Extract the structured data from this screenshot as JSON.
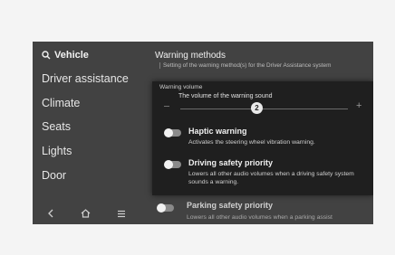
{
  "sidebar": {
    "search_label": "Vehicle",
    "items": [
      {
        "label": "Driver assistance"
      },
      {
        "label": "Climate"
      },
      {
        "label": "Seats"
      },
      {
        "label": "Lights"
      },
      {
        "label": "Door"
      }
    ],
    "bottom_icons": [
      "back-icon",
      "home-icon",
      "menu-icon"
    ]
  },
  "main": {
    "section_title": "Warning methods",
    "section_desc": "Setting of the warning method(s) for the Driver Assistance system",
    "popup": {
      "volume_label": "Warning volume",
      "volume_desc": "The volume of the warning sound",
      "volume_value": "2",
      "options": [
        {
          "title": "Haptic warning",
          "desc": "Activates the steering wheel vibration warning.",
          "enabled": false
        },
        {
          "title": "Driving safety priority",
          "desc": "Lowers all other audio volumes when a driving safety system sounds a warning.",
          "enabled": false
        }
      ]
    },
    "background_option": {
      "title": "Parking safety priority",
      "desc": "Lowers all other audio volumes when a parking assist",
      "enabled": false
    }
  },
  "colors": {
    "screen_bg": "#424242",
    "popup_bg": "#1f1f1f",
    "page_bg": "#f4f4f4"
  }
}
